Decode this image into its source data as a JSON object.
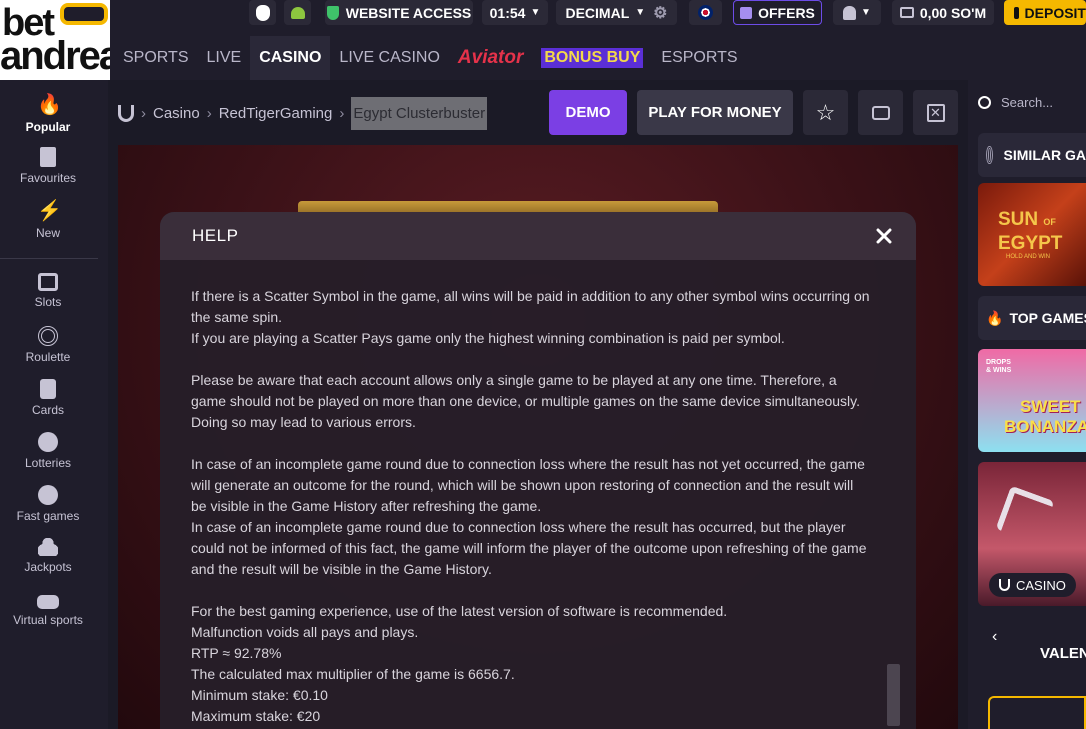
{
  "brand": {
    "line1": "bet",
    "line2": "andreas"
  },
  "header": {
    "website_access": "WEBSITE ACCESS",
    "time": "01:54",
    "odds_format": "DECIMAL",
    "offers": "OFFERS",
    "balance": "0,00 SO'M",
    "deposit": "DEPOSIT"
  },
  "nav": {
    "sports": "SPORTS",
    "live": "LIVE",
    "casino": "CASINO",
    "live_casino": "LIVE CASINO",
    "aviator": "Aviator",
    "bonus_buy": "BONUS BUY",
    "esports": "ESPORTS"
  },
  "sidebar": {
    "items": [
      {
        "label": "Popular"
      },
      {
        "label": "Favourites"
      },
      {
        "label": "New"
      },
      {
        "label": "Slots"
      },
      {
        "label": "Roulette"
      },
      {
        "label": "Cards"
      },
      {
        "label": "Lotteries"
      },
      {
        "label": "Fast games"
      },
      {
        "label": "Jackpots"
      },
      {
        "label": "Virtual sports"
      }
    ]
  },
  "breadcrumb": {
    "casino": "Casino",
    "provider": "RedTigerGaming",
    "game": "Egypt Clusterbuster"
  },
  "actions": {
    "demo": "DEMO",
    "play_for_money": "PLAY FOR MONEY"
  },
  "modal": {
    "title": "HELP",
    "lines": {
      "l1": "If there is a Scatter Symbol in the game, all wins will be paid in addition to any other symbol wins occurring on",
      "l2": "the same spin.",
      "l3": "If you are playing a Scatter Pays game only the highest winning combination is paid per symbol.",
      "l4": "Please be aware that each account allows only a single game to be played at any one time. Therefore, a",
      "l5": "game should not be played on more than one device, or multiple games on the same device simultaneously.",
      "l6": "Doing so may lead to various errors.",
      "l7": "In case of an incomplete game round due to connection loss where the result has not yet occurred, the game",
      "l8": "will generate an outcome for the round, which will be shown upon restoring of connection and the result will",
      "l9": "be visible in the Game History after refreshing the game.",
      "l10": "In case of an incomplete game round due to connection loss where the result has occurred, but the player",
      "l11": "could not be informed of this fact, the game will inform the player of the outcome upon refreshing of the game",
      "l12": "and the result will be visible in the Game History.",
      "l13": "For the best gaming experience, use of the latest version of software is recommended.",
      "l14": "Malfunction voids all pays and plays.",
      "l15": "RTP ≈ 92.78%",
      "l16": "The calculated max multiplier of the game is 6656.7.",
      "l17": "Minimum stake: €0.10",
      "l18": "Maximum stake: €20"
    }
  },
  "right_panel": {
    "search_placeholder": "Search...",
    "similar_games": "SIMILAR GA",
    "top_games": "TOP GAMES",
    "sun_of_egypt": {
      "line1": "SUN",
      "of": "OF",
      "line2": "EGYPT",
      "sub": "HOLD AND WIN"
    },
    "sweet_bonanza": {
      "tag1": "DROPS",
      "tag2": "& WINS",
      "line1": "SWEET",
      "line2": "BONANZA"
    },
    "casino_badge": "CASINO",
    "carousel_label": "VALENT"
  },
  "colors": {
    "accent": "#7b3fe4",
    "gold": "#f5b800",
    "bg": "#1b1a26"
  }
}
